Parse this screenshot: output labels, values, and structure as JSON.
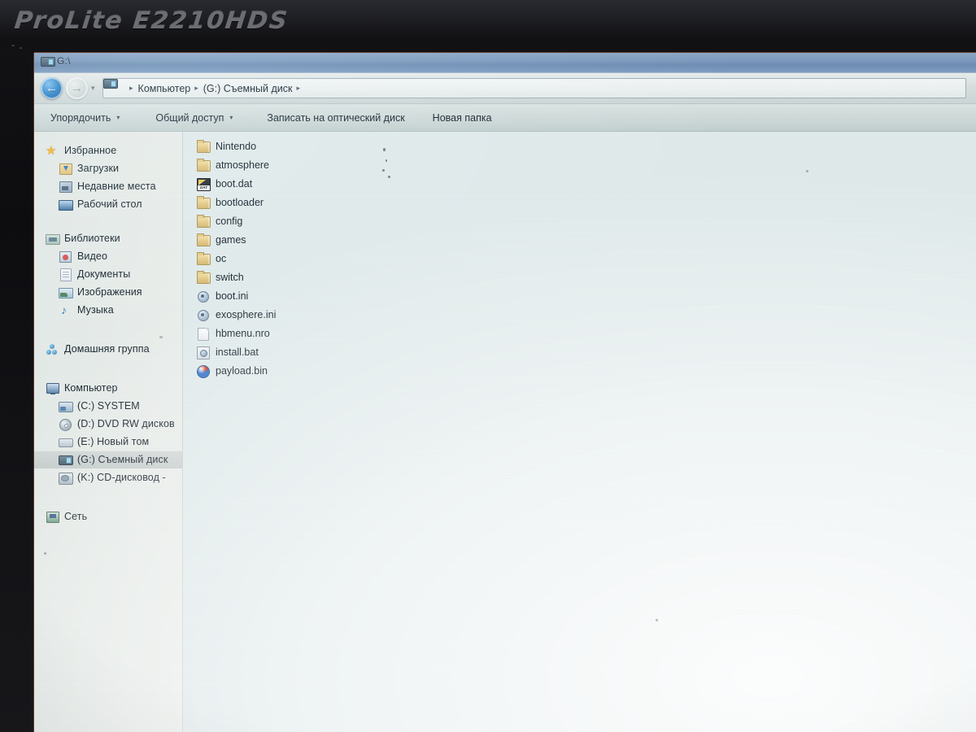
{
  "monitor": {
    "brand_model": "ProLite E2210HDS"
  },
  "window": {
    "title": "G:\\",
    "title_icon": "removable-drive-icon"
  },
  "address_bar": {
    "back_label": "←",
    "forward_label": "→",
    "history_chevron": "▾",
    "crumb_icon": "removable-drive-icon",
    "separator": "▸",
    "crumbs": [
      "Компьютер",
      "(G:) Съемный диск"
    ]
  },
  "toolbar": {
    "chevron": "▾",
    "items": [
      {
        "label": "Упорядочить",
        "has_chevron": true
      },
      {
        "label": "Общий доступ",
        "has_chevron": true
      },
      {
        "label": "Записать на оптический диск",
        "has_chevron": false
      },
      {
        "label": "Новая папка",
        "has_chevron": false
      }
    ]
  },
  "sidebar": {
    "groups": [
      {
        "header": {
          "label": "Избранное",
          "icon": "star-icon"
        },
        "items": [
          {
            "label": "Загрузки",
            "icon": "downloads-folder-icon"
          },
          {
            "label": "Недавние места",
            "icon": "recent-places-icon"
          },
          {
            "label": "Рабочий стол",
            "icon": "desktop-icon"
          }
        ]
      },
      {
        "header": {
          "label": "Библиотеки",
          "icon": "libraries-icon"
        },
        "items": [
          {
            "label": "Видео",
            "icon": "video-library-icon"
          },
          {
            "label": "Документы",
            "icon": "documents-library-icon"
          },
          {
            "label": "Изображения",
            "icon": "pictures-library-icon"
          },
          {
            "label": "Музыка",
            "icon": "music-library-icon"
          }
        ]
      },
      {
        "header": {
          "label": "Домашняя группа",
          "icon": "homegroup-icon"
        },
        "items": []
      },
      {
        "header": {
          "label": "Компьютер",
          "icon": "computer-icon"
        },
        "items": [
          {
            "label": "(C:) SYSTEM",
            "icon": "system-drive-icon",
            "selected": false
          },
          {
            "label": "(D:) DVD RW дисков",
            "icon": "dvd-drive-icon",
            "selected": false
          },
          {
            "label": "(E:) Новый том",
            "icon": "hard-drive-icon",
            "selected": false
          },
          {
            "label": "(G:) Съемный диск",
            "icon": "removable-drive-icon",
            "selected": true
          },
          {
            "label": "(K:) CD-дисковод - ",
            "icon": "cd-drive-icon",
            "selected": false
          }
        ]
      },
      {
        "header": {
          "label": "Сеть",
          "icon": "network-icon"
        },
        "items": []
      }
    ]
  },
  "file_list": {
    "items": [
      {
        "name": "Nintendo",
        "icon": "folder-icon"
      },
      {
        "name": "atmosphere",
        "icon": "folder-icon"
      },
      {
        "name": "boot.dat",
        "icon": "dat-file-icon"
      },
      {
        "name": "bootloader",
        "icon": "folder-icon"
      },
      {
        "name": "config",
        "icon": "folder-icon"
      },
      {
        "name": "games",
        "icon": "folder-icon"
      },
      {
        "name": "oc",
        "icon": "folder-icon"
      },
      {
        "name": "switch",
        "icon": "folder-icon"
      },
      {
        "name": "boot.ini",
        "icon": "ini-file-icon"
      },
      {
        "name": "exosphere.ini",
        "icon": "ini-file-icon"
      },
      {
        "name": "hbmenu.nro",
        "icon": "blank-file-icon"
      },
      {
        "name": "install.bat",
        "icon": "bat-script-icon"
      },
      {
        "name": "payload.bin",
        "icon": "bin-file-icon"
      }
    ]
  },
  "colors": {
    "titlebar": "#7d9abe",
    "toolbar": "#cdd8d7",
    "sidebar": "#e6ebe8",
    "content": "#dfe9ea",
    "selection": "#bec6c6",
    "folder": "#e3c981",
    "bezel": "#121215"
  }
}
